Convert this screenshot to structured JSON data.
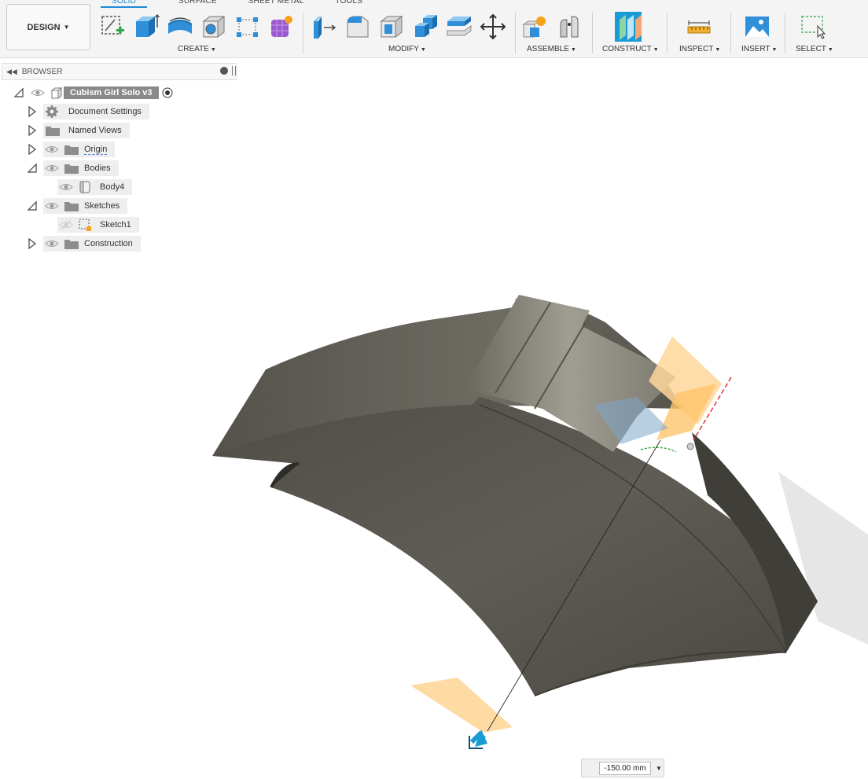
{
  "workspace_button": "DESIGN",
  "tabs": [
    "SOLID",
    "SURFACE",
    "SHEET METAL",
    "TOOLS"
  ],
  "toolbar_groups": {
    "create": "CREATE",
    "modify": "MODIFY",
    "assemble": "ASSEMBLE",
    "construct": "CONSTRUCT",
    "inspect": "INSPECT",
    "insert": "INSERT",
    "select": "SELECT"
  },
  "browser": {
    "title": "BROWSER",
    "root": "Cubism Girl Solo v3",
    "items": {
      "document_settings": "Document Settings",
      "named_views": "Named Views",
      "origin": "Origin",
      "bodies": "Bodies",
      "body4": "Body4",
      "sketches": "Sketches",
      "sketch1": "Sketch1",
      "construction": "Construction"
    }
  },
  "viewport": {
    "dimension_label": "150.00",
    "dimension_input": "-150.00 mm"
  },
  "colors": {
    "accent": "#1e8ad6",
    "body_gray": "#5a5850",
    "plane_orange": "#ffd79a"
  },
  "icons": [
    "sketch-icon",
    "extrude-icon",
    "revolve-icon",
    "hole-icon",
    "rect-pattern-icon",
    "form-icon",
    "press-pull-icon",
    "fillet-icon",
    "shell-icon",
    "combine-icon",
    "offset-face-icon",
    "move-icon",
    "new-component-icon",
    "joint-icon",
    "plane-icon",
    "measure-icon",
    "insert-image-icon",
    "select-window-icon"
  ]
}
